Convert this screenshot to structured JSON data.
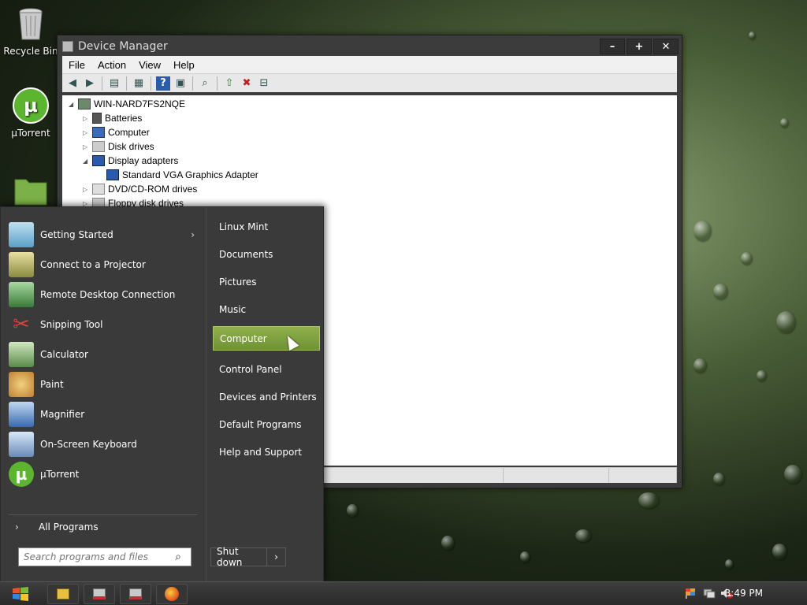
{
  "desktop": {
    "icons": [
      {
        "label": "Recycle Bin"
      },
      {
        "label": "µTorrent"
      }
    ]
  },
  "device_manager": {
    "title": "Device Manager",
    "window_buttons": {
      "minimize": "–",
      "maximize": "+",
      "close": "✕"
    },
    "menu": [
      "File",
      "Action",
      "View",
      "Help"
    ],
    "tree": {
      "root": "WIN-NARD7FS2NQE",
      "nodes": [
        "Batteries",
        "Computer",
        "Disk drives",
        "Display adapters",
        "Standard VGA Graphics Adapter",
        "DVD/CD-ROM drives",
        "Floppy disk drives"
      ]
    }
  },
  "start_menu": {
    "programs": [
      "Getting Started",
      "Connect to a Projector",
      "Remote Desktop Connection",
      "Snipping Tool",
      "Calculator",
      "Paint",
      "Magnifier",
      "On-Screen Keyboard",
      "µTorrent"
    ],
    "all_programs": "All Programs",
    "search_placeholder": "Search programs and files",
    "right_links": [
      "Linux Mint",
      "Documents",
      "Pictures",
      "Music",
      "Computer",
      "Control Panel",
      "Devices and Printers",
      "Default Programs",
      "Help and Support"
    ],
    "highlighted_link": "Computer",
    "shutdown": "Shut down"
  },
  "taskbar": {
    "clock": "3:49 PM"
  },
  "colors": {
    "highlight": "#7fa440",
    "start_menu_bg": "#3a3a3a",
    "taskbar_bg": "#333333"
  }
}
